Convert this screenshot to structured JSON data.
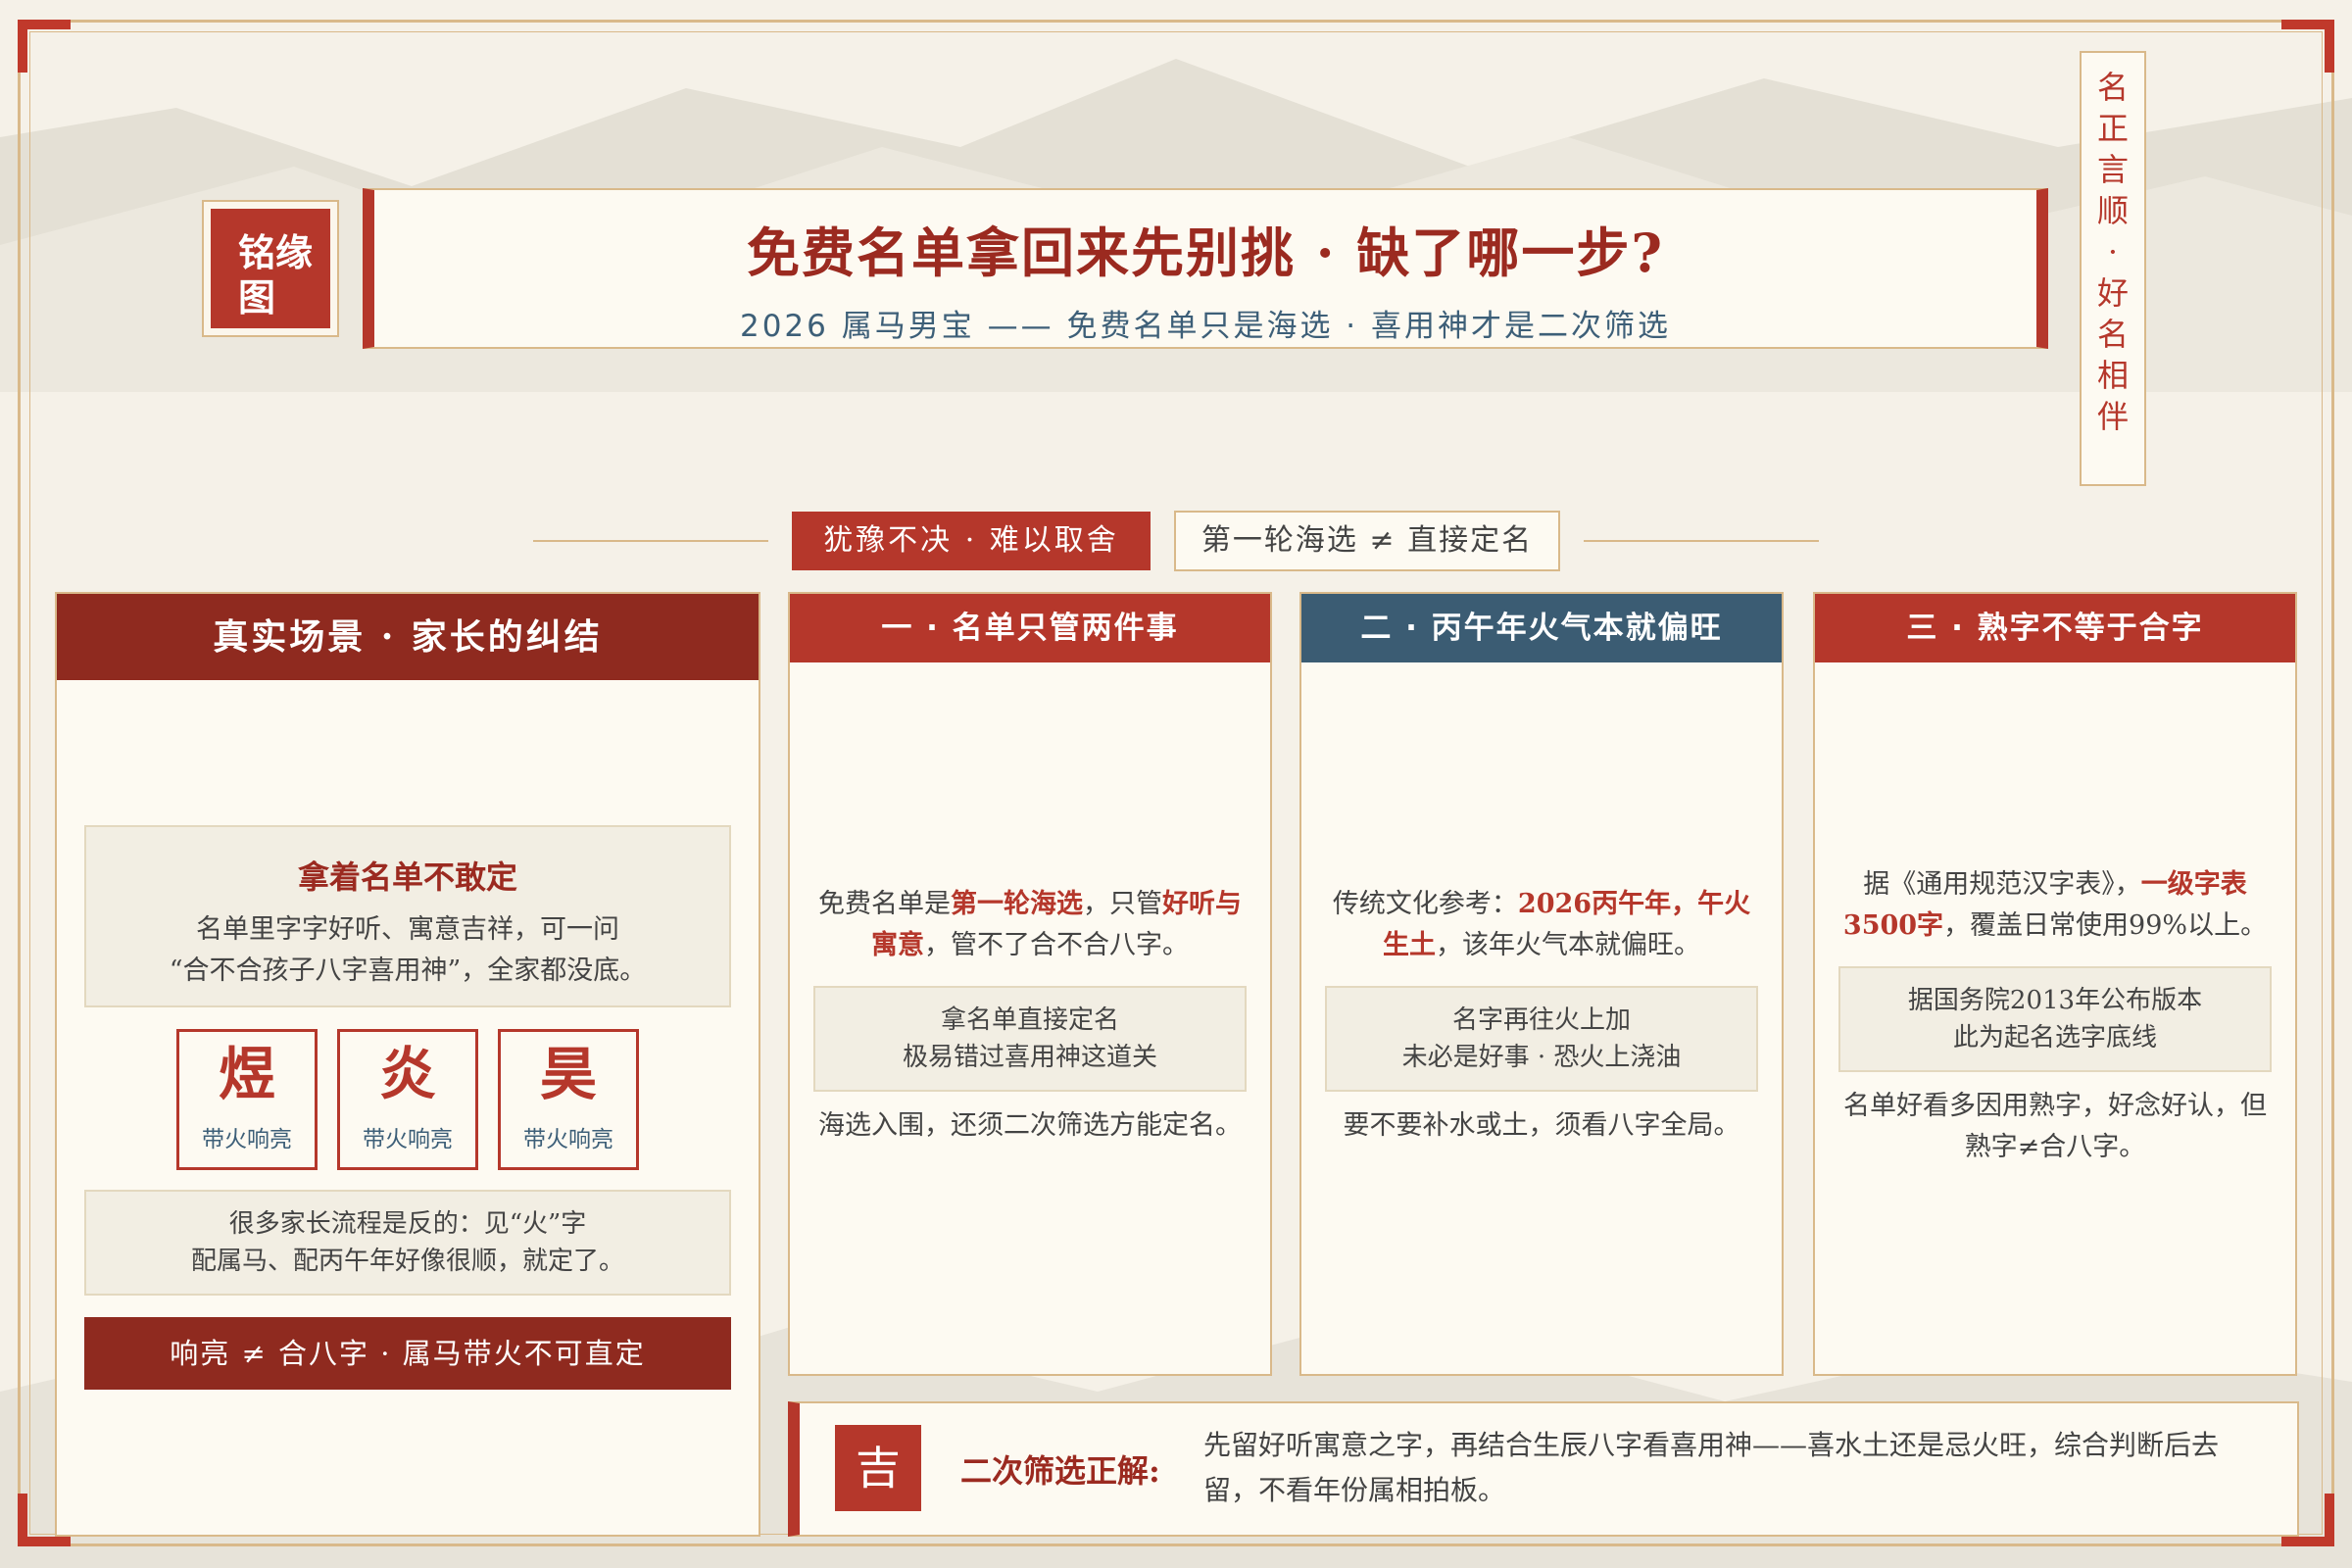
{
  "logo": {
    "text": "铭缘图"
  },
  "header": {
    "title": "免费名单拿回来先别挑 · 缺了哪一步?",
    "subtitle": "2026 属马男宝 —— 免费名单只是海选 · 喜用神才是二次筛选"
  },
  "motto": [
    "名",
    "正",
    "言",
    "顺",
    "·",
    "好",
    "名",
    "相",
    "伴"
  ],
  "tags": {
    "primary": "犹豫不决 · 难以取舍",
    "secondary": "第一轮海选 ≠ 直接定名"
  },
  "scene": {
    "header": "真实场景 · 家长的纠结",
    "quote_title": "拿着名单不敢定",
    "quote_line1": "名单里字字好听、寓意吉祥，可一问",
    "quote_line2": "“合不合孩子八字喜用神”，全家都没底。",
    "chars": [
      {
        "char": "煜",
        "caption": "带火响亮"
      },
      {
        "char": "炎",
        "caption": "带火响亮"
      },
      {
        "char": "昊",
        "caption": "带火响亮"
      }
    ],
    "note_line1": "很多家长流程是反的：见“火”字",
    "note_line2": "配属马、配丙午年好像很顺，就定了。",
    "banner": "响亮 ≠ 合八字 · 属马带火不可直定"
  },
  "columns": [
    {
      "header": "一 · 名单只管两件事",
      "p1_a": "免费名单是",
      "p1_b": "第一轮海选",
      "p1_c": "，只管",
      "p1_d": "好听与寓意",
      "p1_e": "，管不了合不合八字。",
      "box_line1": "拿名单直接定名",
      "box_line2": "极易错过喜用神这道关",
      "footer": "海选入围，还须二次筛选方能定名。"
    },
    {
      "header": "二 · 丙午年火气本就偏旺",
      "p1_a": "传统文化参考：",
      "p1_b": "2026丙午年，午火生土",
      "p1_c": "，该年火气本就偏旺。",
      "box_line1": "名字再往火上加",
      "box_line2": "未必是好事 · 恐火上浇油",
      "footer": "要不要补水或土，须看八字全局。"
    },
    {
      "header": "三 · 熟字不等于合字",
      "p1_a": "据《通用规范汉字表》，",
      "p1_b": "一级字表3500字",
      "p1_c": "，覆盖日常使用99%以上。",
      "box_line1": "据国务院2013年公布版本",
      "box_line2": "此为起名选字底线",
      "footer": "名单好看多因用熟字，好念好认，但熟字≠合八字。"
    }
  ],
  "summary": {
    "badge": "吉",
    "label": "二次筛选正解:",
    "text": "先留好听寓意之字，再结合生辰八字看喜用神——喜水土还是忌火旺，综合判断后去留，不看年份属相拍板。"
  },
  "colors": {
    "red": "#b5372b",
    "dark_red": "#8f2a1f",
    "blue": "#3b5c73",
    "gold": "#d9b98a",
    "paper": "#fdfaf2"
  }
}
